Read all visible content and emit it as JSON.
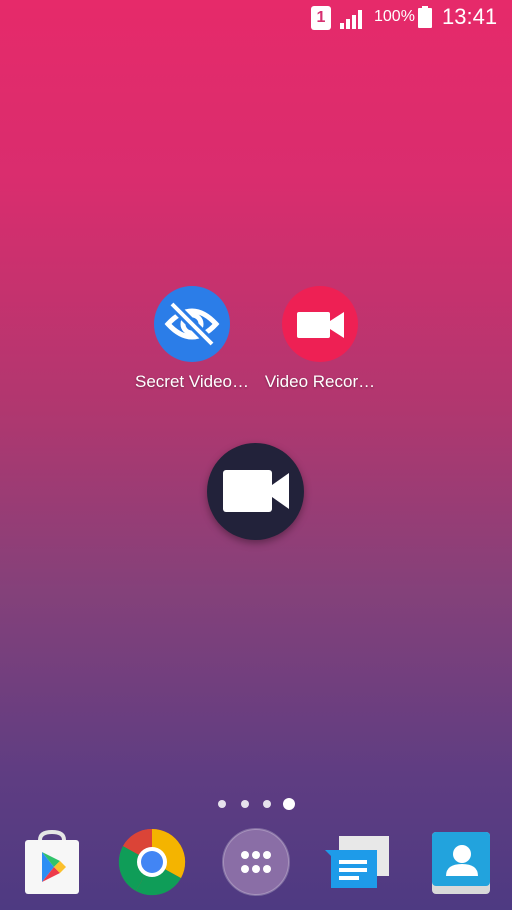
{
  "status_bar": {
    "sim_slot": "1",
    "battery_percent": "100%",
    "time": "13:41",
    "icons": [
      "sim-icon",
      "signal-icon",
      "battery-icon"
    ]
  },
  "home": {
    "apps": [
      {
        "label": "Secret Video…",
        "icon": "eye-off-icon",
        "color": "#2b7de8"
      },
      {
        "label": "Video Recor…",
        "icon": "video-camera-icon",
        "color": "#ee2054"
      }
    ],
    "floating_button": {
      "icon": "video-camera-icon",
      "color": "#22223a"
    },
    "page_indicator": {
      "pages": 4,
      "current": 4
    }
  },
  "dock": {
    "items": [
      {
        "name": "play-store-icon"
      },
      {
        "name": "chrome-icon"
      },
      {
        "name": "app-drawer-icon"
      },
      {
        "name": "messages-icon"
      },
      {
        "name": "contacts-icon"
      }
    ]
  }
}
